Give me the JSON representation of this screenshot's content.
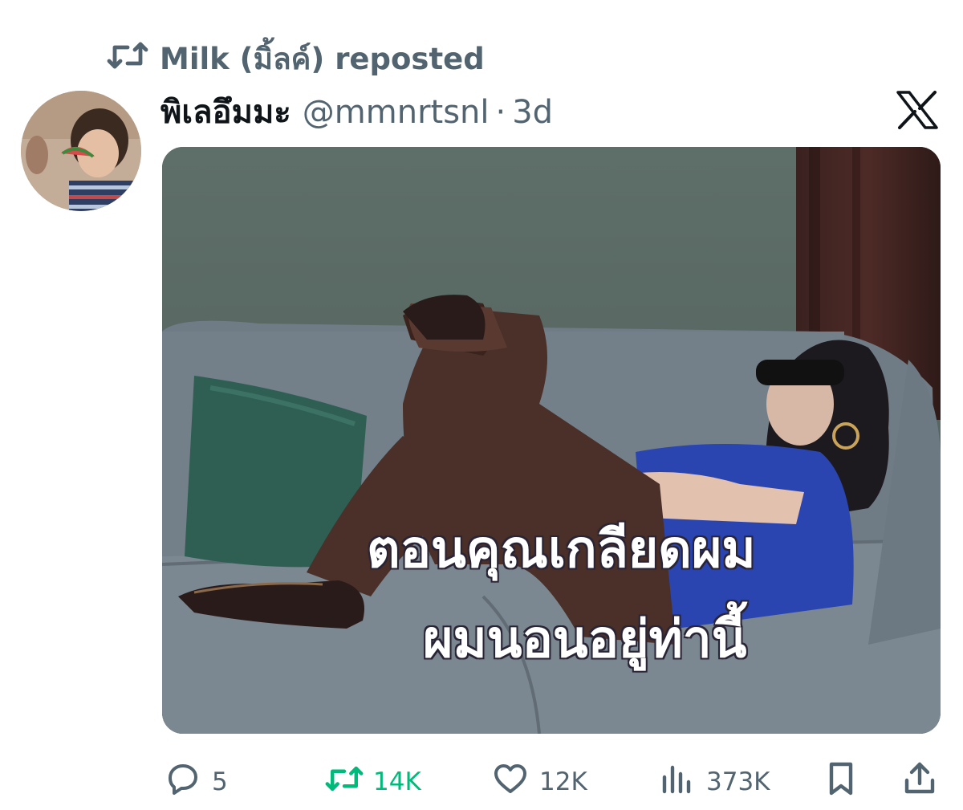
{
  "repost": {
    "icon": "repost-icon",
    "text": "Milk (มิ้ลค์) reposted"
  },
  "tweet": {
    "avatar_icon": "avatar",
    "display_name": "พิเลอึมมะ",
    "handle": "@mmnrtsnl",
    "separator": "·",
    "time": "3d",
    "platform_icon": "x-logo-icon",
    "media": {
      "caption_line_1": "ตอนคุณเกลียดผม",
      "caption_line_2": "ผมนอนอยู่ท่านี้"
    }
  },
  "actions": {
    "reply": {
      "icon": "reply-icon",
      "count": "5"
    },
    "retweet": {
      "icon": "retweet-icon",
      "count": "14K",
      "color": "#00ba7c"
    },
    "like": {
      "icon": "heart-icon",
      "count": "12K"
    },
    "views": {
      "icon": "views-icon",
      "count": "373K"
    },
    "bookmark": {
      "icon": "bookmark-icon"
    },
    "share": {
      "icon": "share-icon"
    }
  },
  "colors": {
    "text_primary": "#0f1419",
    "text_secondary": "#536471",
    "retweet_active": "#00ba7c"
  }
}
